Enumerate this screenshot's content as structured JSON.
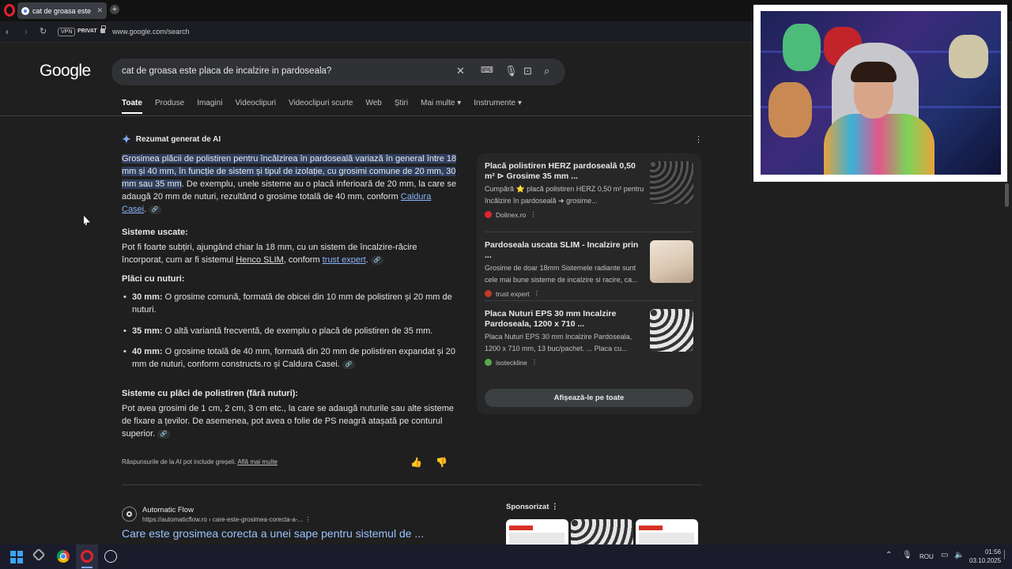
{
  "browser": {
    "tab_title": "cat de groasa este placa d",
    "new_tab": "+",
    "vpn_label": "VPN",
    "private_label": "PRIVAT",
    "url": "www.google.com/search"
  },
  "google": {
    "logo": "Google",
    "query": "cat de groasa este placa de incalzire in pardoseala?",
    "tabs": [
      "Toate",
      "Produse",
      "Imagini",
      "Videoclipuri",
      "Videoclipuri scurte",
      "Web",
      "Știri",
      "Mai multe",
      "Instrumente"
    ]
  },
  "ai_overview": {
    "header": "Rezumat generat de AI",
    "intro_highlight": "Grosimea plăcii de polistiren pentru încălzirea în pardoseală variază în general între 18 mm și 40 mm, în funcție de sistem și tipul de izolație, cu grosimi comune de 20 mm, 30 mm sau 35 mm",
    "intro_rest": ". De exemplu, unele sisteme au o placă inferioară de 20 mm, la care se adaugă 20 mm de nuturi, rezultând o grosime totală de 40 mm, conform ",
    "intro_link": "Caldura Casei",
    "sect1_title": "Sisteme uscate:",
    "sect1_text": "Pot fi foarte subțiri, ajungând chiar la 18 mm, cu un sistem de încalzire-răcire încorporat, cum ar fi sistemul ",
    "sect1_underlined": "Henco SLIM",
    "sect1_mid": ", conform ",
    "sect1_link": "trust expert",
    "sect2_title": "Plăci cu nuturi:",
    "bullet1_bold": "30 mm:",
    "bullet1_text": " O grosime comună, formată de obicei din 10 mm de polistiren și 20 mm de nuturi.",
    "bullet2_bold": "35 mm:",
    "bullet2_text": " O altă variantă frecventă, de exemplu o placă de polistiren de 35 mm.",
    "bullet3_bold": "40 mm:",
    "bullet3_text": " O grosime totală de 40 mm, formată din 20 mm de polistiren expandat și 20 mm de nuturi, conform constructs.ro și Caldura Casei.",
    "sect3_title": "Sisteme cu plăci de polistiren (fără nuturi):",
    "sect3_text": "Pot avea grosimi de 1 cm, 2 cm, 3 cm etc., la care se adaugă nuturile sau alte sisteme de fixare a țevilor. De asemenea, pot avea o folie de PS neagră atașată pe conturul superior.",
    "disclaimer": "Răspunsurile de la AI pot include greșeli. ",
    "learn_more": "Află mai multe"
  },
  "sources": [
    {
      "title": "Placă polistiren HERZ pardoseală 0,50 m² ⊳ Grosime 35 mm ...",
      "desc": "Cumpără ⭐ placă polistiren HERZ 0,50 m² pentru încălzire în pardoseală ➜ grosime...",
      "site": "Dolinex.ro"
    },
    {
      "title": "Pardoseala uscata SLIM - Incalzire prin ...",
      "desc": "Grosime de doar 18mm Sistemele radiante sunt cele mai bune sisteme de incalzire si racire, ca...",
      "site": "trust expert"
    },
    {
      "title": "Placa Nuturi EPS 30 mm Incalzire Pardoseala, 1200 x 710 ...",
      "desc": "Placa Nuturi EPS 30 mm Incalzire Pardoseala, 1200 x 710 mm, 13 buc/pachet. ... Placa cu...",
      "site": "isotecklin​e"
    }
  ],
  "show_all": "Afișează-le pe toate",
  "result": {
    "site": "Automatic Flow",
    "url": "https://automaticflow.ro › care-este-grosimea-corecta-a-...",
    "title": "Care este grosimea corecta a unei sape pentru sistemul de ..."
  },
  "sponsored": "Sponsorizat",
  "taskbar": {
    "lang": "ROU",
    "time": "01:56",
    "date": "03.10.2025"
  },
  "colors": {
    "background": "#1f1f1f",
    "link": "#8ab4f8",
    "highlight": "#303f5e",
    "opera_red": "#e0242f"
  }
}
